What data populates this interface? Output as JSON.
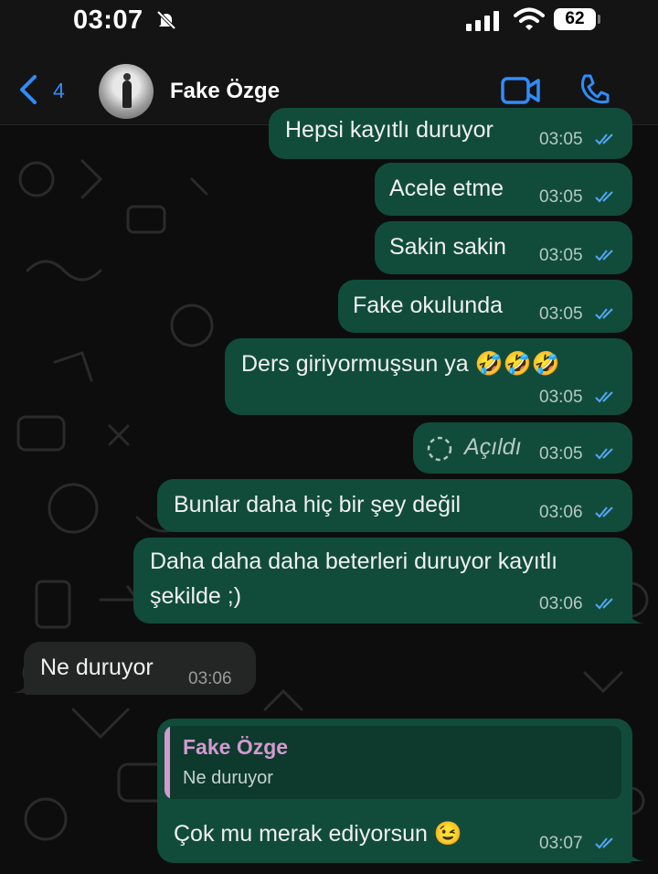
{
  "status_bar": {
    "time": "03:07",
    "battery": "62"
  },
  "header": {
    "back_count": "4",
    "contact_name": "Fake Özge"
  },
  "colors": {
    "accent": "#2f8dfb",
    "outgoing_bubble": "#114c3a",
    "incoming_bubble": "#242626",
    "quote_name": "#d39ad0"
  },
  "messages": [
    {
      "direction": "out",
      "text": "Hepsi kayıtlı duruyor",
      "time": "03:05"
    },
    {
      "direction": "out",
      "text": "Acele etme",
      "time": "03:05"
    },
    {
      "direction": "out",
      "text": "Sakin sakin",
      "time": "03:05"
    },
    {
      "direction": "out",
      "text": "Fake okulunda",
      "time": "03:05"
    },
    {
      "direction": "out",
      "text": "Ders giriyormuşsun ya",
      "emoji": "🤣🤣🤣",
      "time": "03:05"
    },
    {
      "direction": "out",
      "text": "Açıldı",
      "time": "03:05",
      "kind": "view-once-opened"
    },
    {
      "direction": "out",
      "text": "Bunlar daha hiç bir şey değil",
      "time": "03:06"
    },
    {
      "direction": "out",
      "text_line1": "Daha daha daha beterleri duruyor kayıtlı",
      "text_line2": "şekilde ;)",
      "time": "03:06"
    },
    {
      "direction": "in",
      "text": "Ne duruyor",
      "time": "03:06"
    },
    {
      "direction": "out",
      "quote_name": "Fake Özge",
      "quote_text": "Ne duruyor",
      "text": "Çok mu merak ediyorsun",
      "emoji": "😉",
      "time": "03:07"
    }
  ]
}
